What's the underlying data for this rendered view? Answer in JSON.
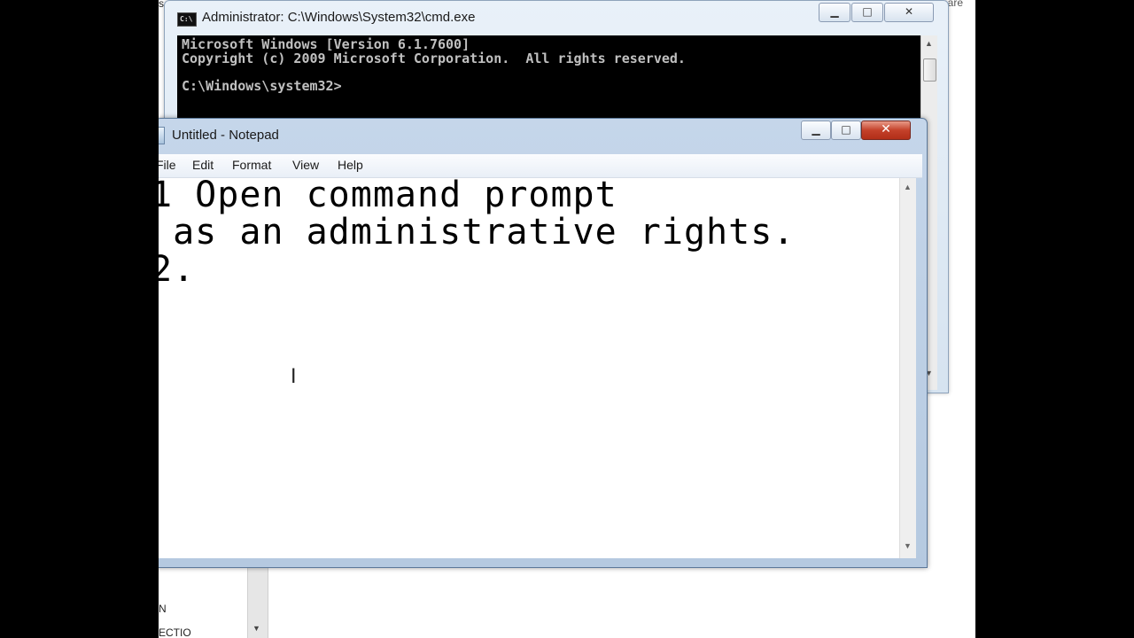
{
  "background": {
    "top_left_fragment": "s",
    "top_right_fragment": "nare",
    "bottom_fragment_1": "N",
    "bottom_fragment_2": "ECTIO"
  },
  "cmd": {
    "title": "Administrator: C:\\Windows\\System32\\cmd.exe",
    "icon_text": "C:\\",
    "buttons": {
      "minimize": "▁",
      "maximize": "□",
      "close": "✕"
    },
    "console_lines": [
      "Microsoft Windows [Version 6.1.7600]",
      "Copyright (c) 2009 Microsoft Corporation.  All rights reserved.",
      "C:\\Windows\\system32>"
    ]
  },
  "notepad": {
    "title": "Untitled - Notepad",
    "buttons": {
      "minimize": "▁",
      "maximize": "□",
      "close": "✕"
    },
    "menu": [
      "File",
      "Edit",
      "Format",
      "View",
      "Help"
    ],
    "content_lines": [
      "1 Open command prompt",
      " as an administrative rights.",
      "2."
    ],
    "cursor_glyph": "I"
  },
  "colors": {
    "console_bg": "#000000",
    "console_fg": "#c0c0c0",
    "close_button": "#c4412a",
    "window_frame": "#c5d6ea"
  }
}
